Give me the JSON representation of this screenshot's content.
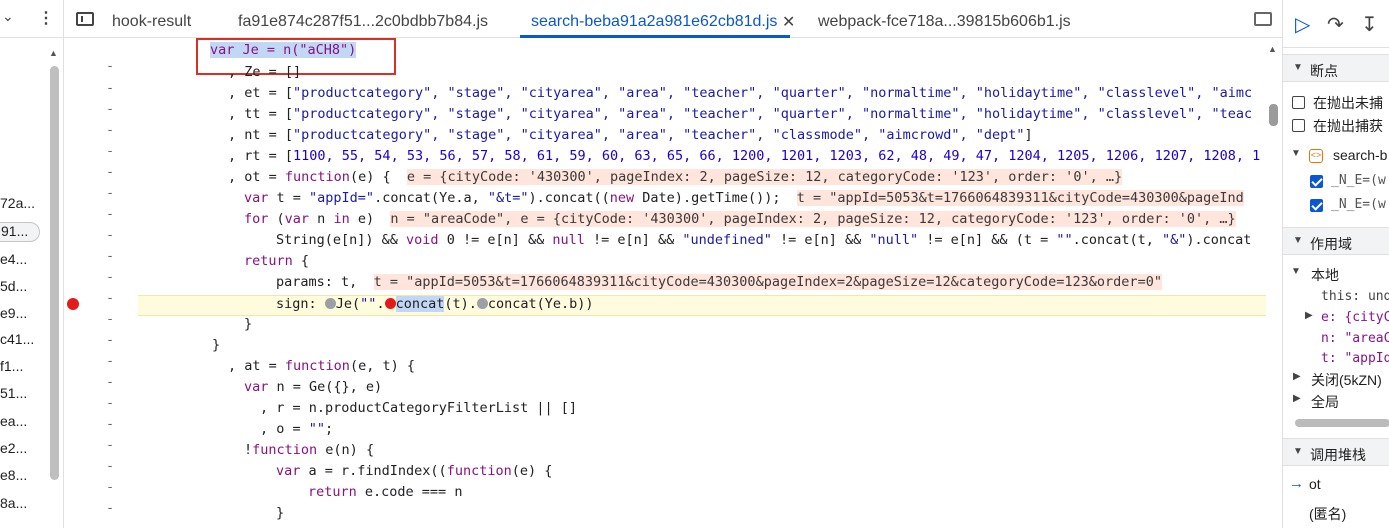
{
  "left_panel": {
    "files": [
      "72a...",
      "91...",
      "e4...",
      "5d...",
      "e9...",
      "c41...",
      "f1...",
      "51...",
      "ea...",
      "e2...",
      "e8...",
      "8a..."
    ],
    "selected_index": 1
  },
  "tabs": {
    "items": [
      {
        "label": "hook-result"
      },
      {
        "label": "fa91e874c287f51...2c0bdbb7b84.js"
      },
      {
        "label": "search-beba91a2a981e62cb81d.js"
      },
      {
        "label": "webpack-fce718a...39815b606b1.js"
      }
    ],
    "active_index": 2
  },
  "code": {
    "gutter_mark": "-",
    "lines": {
      "l0": "var Je = n(\"aCH8\")",
      "l1": ", Ze = []",
      "l2a": ", et = [",
      "l2b": "\"productcategory\", \"stage\", \"cityarea\", \"area\", \"teacher\", \"quarter\", \"normaltime\", \"holidaytime\", \"classlevel\", \"aimc",
      "l3a": ", tt = [",
      "l3b": "\"productcategory\", \"stage\", \"cityarea\", \"area\", \"teacher\", \"quarter\", \"normaltime\", \"holidaytime\", \"classlevel\", \"teac",
      "l4a": ", nt = [",
      "l4b": "\"productcategory\", \"stage\", \"cityarea\", \"area\", \"teacher\", \"classmode\", \"aimcrowd\", \"dept\"",
      "l4c": "]",
      "l5a": ", rt = [",
      "l5b": "1100, 55, 54, 53, 56, 57, 58, 61, 59, 60, 63, 65, 66, 1200, 1201, 1203, 62, 48, 49, 47, 1204, 1205, 1206, 1207, 1208, 1",
      "l6a": ", ot = ",
      "l6b": "function",
      "l6c": "(e) {  ",
      "l6d": "e = {cityCode: '430300', pageIndex: 2, pageSize: 12, categoryCode: '123', order: '0', …}",
      "l7a": "var",
      "l7b": " t = ",
      "l7c": "\"appId=\"",
      "l7d": ".concat(Ye.a, ",
      "l7e": "\"&t=\"",
      "l7f": ").concat((",
      "l7g": "new",
      "l7h": " Date).getTime());  ",
      "l7i": "t = \"appId=5053&t=1766064839311&cityCode=430300&pageInd",
      "l8a": "for",
      "l8b": " (",
      "l8c": "var",
      "l8d": " n ",
      "l8e": "in",
      "l8f": " e)  ",
      "l8g": "n = \"areaCode\", e = {cityCode: '430300', pageIndex: 2, pageSize: 12, categoryCode: '123', order: '0', …}",
      "l9a": "String(e[n]) && ",
      "l9b": "void",
      "l9c": " 0 != e[n] && ",
      "l9d": "null",
      "l9e": " != e[n] && ",
      "l9f": "\"undefined\"",
      "l9g": " != e[n] && ",
      "l9h": "\"null\"",
      "l9i": " != e[n] && (t = ",
      "l9j": "\"\"",
      "l9k": ".concat(t, ",
      "l9l": "\"&\"",
      "l9m": ").concat",
      "l10": "return",
      "l10b": " {",
      "l11a": "params",
      "l11b": ": t,  ",
      "l11c": "t = \"appId=5053&t=1766064839311&cityCode=430300&pageIndex=2&pageSize=12&categoryCode=123&order=0\"",
      "l12a": "sign",
      "l12b": ": ",
      "l12c": "Je(",
      "l12d": "\"\"",
      "l12e": ".",
      "l12f": "concat",
      "l12g": "(t).",
      "l12h": "concat(Ye.b))",
      "l13": "}",
      "l14": "}",
      "l15a": ", at = ",
      "l15b": "function",
      "l15c": "(e, t) {",
      "l16a": "var",
      "l16b": " n = Ge({}, e)",
      "l17": ", r = n.productCategoryFilterList || []",
      "l18a": ", o = ",
      "l18b": "\"\"",
      "l18c": ";",
      "l19a": "!",
      "l19b": "function",
      "l19c": " e(n) {",
      "l20a": "var",
      "l20b": " a = r.findIndex((",
      "l20c": "function",
      "l20d": "(e) {",
      "l21a": "return",
      "l21b": " e.code === n",
      "l22": "}"
    }
  },
  "right_panel": {
    "breakpoints_label": "断点",
    "pause_uncaught_label": "在抛出未捕",
    "pause_caught_label": "在抛出捕获",
    "bp_file": "search-b",
    "bp_items": [
      "_N_E=(w",
      "_N_E=(w"
    ],
    "scope_label": "作用域",
    "local_label": "本地",
    "this_label": "this: und",
    "e_label": "e: {cityC",
    "n_label": "n: \"areaC",
    "t_label": "t: \"appId",
    "closure_label": "关闭(5kZN)",
    "global_label": "全局",
    "callstack_label": "调用堆栈",
    "frame1": "ot",
    "frame2": "(匿名)"
  }
}
